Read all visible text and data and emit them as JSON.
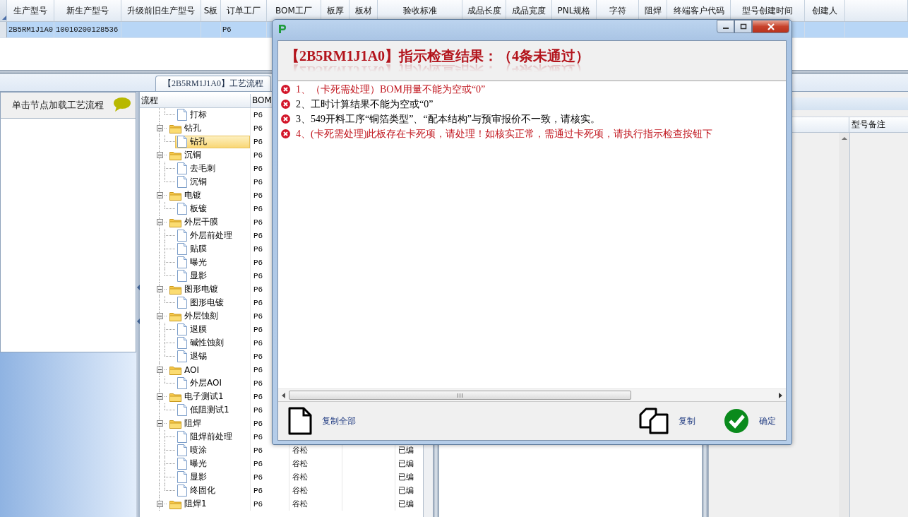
{
  "grid": {
    "columns": [
      {
        "label": "生产型号"
      },
      {
        "label": "新生产型号"
      },
      {
        "label": "升级前旧生产型号"
      },
      {
        "label": "S板"
      },
      {
        "label": "订单工厂"
      },
      {
        "label": "BOM工厂"
      },
      {
        "label": "板厚"
      },
      {
        "label": "板材"
      },
      {
        "label": "验收标准"
      },
      {
        "label": "成品长度"
      },
      {
        "label": "成品宽度"
      },
      {
        "label": "PNL规格"
      },
      {
        "label": "字符"
      },
      {
        "label": "阻焊"
      },
      {
        "label": "终端客户代码"
      },
      {
        "label": "型号创建时间"
      },
      {
        "label": "创建人"
      }
    ],
    "rows": [
      {
        "selected": true,
        "cells": [
          "2B5RM1J1A0",
          "10010200128536",
          null,
          null,
          "P6"
        ]
      }
    ]
  },
  "tab": {
    "label": "【2B5RM1J1A0】工艺流程",
    "selected": true
  },
  "left_panel": {
    "title": "单击节点加载工艺流程"
  },
  "tree": {
    "columns": [
      "流程",
      "BOM"
    ],
    "nodes": [
      {
        "children": [
          {
            "label": "打标",
            "kind": "file",
            "selected": false,
            "bom": "P6"
          }
        ]
      },
      {
        "label": "钻孔",
        "kind": "folder",
        "expanded": true,
        "selected": false,
        "bom": "P6",
        "children": [
          {
            "label": "钻孔",
            "kind": "file",
            "selected": true,
            "bom": "P6"
          }
        ]
      },
      {
        "label": "沉铜",
        "kind": "folder",
        "expanded": true,
        "selected": false,
        "bom": "P6",
        "children": [
          {
            "label": "去毛刺",
            "kind": "file",
            "selected": false,
            "bom": "P6"
          },
          {
            "label": "沉铜",
            "kind": "file",
            "selected": false,
            "bom": "P6"
          }
        ]
      },
      {
        "label": "电镀",
        "kind": "folder",
        "expanded": true,
        "selected": false,
        "bom": "P6",
        "children": [
          {
            "label": "板镀",
            "kind": "file",
            "selected": false,
            "bom": "P6"
          }
        ]
      },
      {
        "label": "外层干膜",
        "kind": "folder",
        "expanded": true,
        "selected": false,
        "bom": "P6",
        "children": [
          {
            "label": "外层前处理",
            "kind": "file",
            "selected": false,
            "bom": "P6"
          },
          {
            "label": "贴膜",
            "kind": "file",
            "selected": false,
            "bom": "P6"
          },
          {
            "label": "曝光",
            "kind": "file",
            "selected": false,
            "bom": "P6"
          },
          {
            "label": "显影",
            "kind": "file",
            "selected": false,
            "bom": "P6"
          }
        ]
      },
      {
        "label": "图形电镀",
        "kind": "folder",
        "expanded": true,
        "selected": false,
        "bom": "P6",
        "children": [
          {
            "label": "图形电镀",
            "kind": "file",
            "selected": false,
            "bom": "P6"
          }
        ]
      },
      {
        "label": "外层蚀刻",
        "kind": "folder",
        "expanded": true,
        "selected": false,
        "bom": "P6",
        "children": [
          {
            "label": "退膜",
            "kind": "file",
            "selected": false,
            "bom": "P6"
          },
          {
            "label": "碱性蚀刻",
            "kind": "file",
            "selected": false,
            "bom": "P6"
          },
          {
            "label": "退锡",
            "kind": "file",
            "selected": false,
            "bom": "P6"
          }
        ]
      },
      {
        "label": "AOI",
        "kind": "folder",
        "expanded": true,
        "selected": false,
        "bom": "P6",
        "children": [
          {
            "label": "外层AOI",
            "kind": "file",
            "selected": false,
            "bom": "P6"
          }
        ]
      },
      {
        "label": "电子测试1",
        "kind": "folder",
        "expanded": true,
        "selected": false,
        "bom": "P6",
        "children": [
          {
            "label": "低阻测试1",
            "kind": "file",
            "selected": false,
            "bom": "P6"
          }
        ]
      },
      {
        "label": "阻焊",
        "kind": "folder",
        "expanded": true,
        "selected": false,
        "bom": "P6",
        "children": [
          {
            "label": "阻焊前处理",
            "kind": "file",
            "selected": false,
            "bom": "P6"
          },
          {
            "label": "喷涂",
            "kind": "file",
            "selected": false,
            "bom": "P6",
            "column_3": "谷松",
            "column_5": "已编"
          },
          {
            "label": "曝光",
            "kind": "file",
            "selected": false,
            "bom": "P6",
            "column_3": "谷松",
            "column_5": "已编"
          },
          {
            "label": "显影",
            "kind": "file",
            "selected": false,
            "bom": "P6",
            "column_3": "谷松",
            "column_5": "已编"
          },
          {
            "label": "终固化",
            "kind": "file",
            "selected": false,
            "bom": "P6",
            "column_3": "谷松",
            "column_5": "已编"
          }
        ]
      },
      {
        "label": "阻焊1",
        "kind": "folder",
        "expanded": true,
        "selected": false,
        "bom": "P6",
        "column_3": "谷松",
        "column_5": "已编"
      }
    ]
  },
  "right_panel": {
    "columns": [
      "型号备注"
    ]
  },
  "dialog": {
    "heading": "【2B5RM1J1A0】指示检查结果：（4条未通过）",
    "messages": [
      {
        "text": "1、（卡死需处理）BOM用量不能为空或“0”",
        "color": "#c0141c"
      },
      {
        "text": "2、工时计算结果不能为空或“0”",
        "color": "#000000"
      },
      {
        "text": "3、549开料工序“铜箔类型”、“配本结构”与预审报价不一致，请核实。",
        "color": "#000000"
      },
      {
        "text": "4、(卡死需处理)此板存在卡死项，请处理！如核实正常，需通过卡死项，请执行指示检查按钮下",
        "color": "#c0141c"
      }
    ],
    "buttons": [
      {
        "label": "复制全部",
        "kind": "copy_all"
      },
      {
        "label": "复制",
        "kind": "copy"
      },
      {
        "label": "确定",
        "kind": "ok"
      }
    ]
  }
}
